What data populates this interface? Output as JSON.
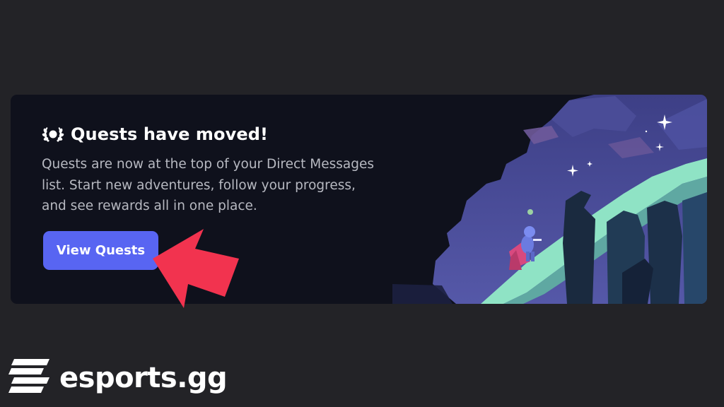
{
  "card": {
    "title": "Quests have moved!",
    "description": "Quests are now at the top of your Direct Messages list. Start new adventures, follow your progress, and see rewards all in one place.",
    "button_label": "View Quests",
    "title_icon": "laurel-wreath-icon",
    "illustration": "fantasy-cliff-illustration"
  },
  "annotation": {
    "arrow_icon": "pointer-arrow-icon",
    "color": "#f2334f"
  },
  "watermark": {
    "name": "esports.gg",
    "logo_icon": "esports-gg-logo"
  },
  "colors": {
    "background": "#232327",
    "card_background": "#0f111c",
    "button": "#5865f2",
    "title": "#ffffff",
    "body_text": "#b7b9c1"
  }
}
